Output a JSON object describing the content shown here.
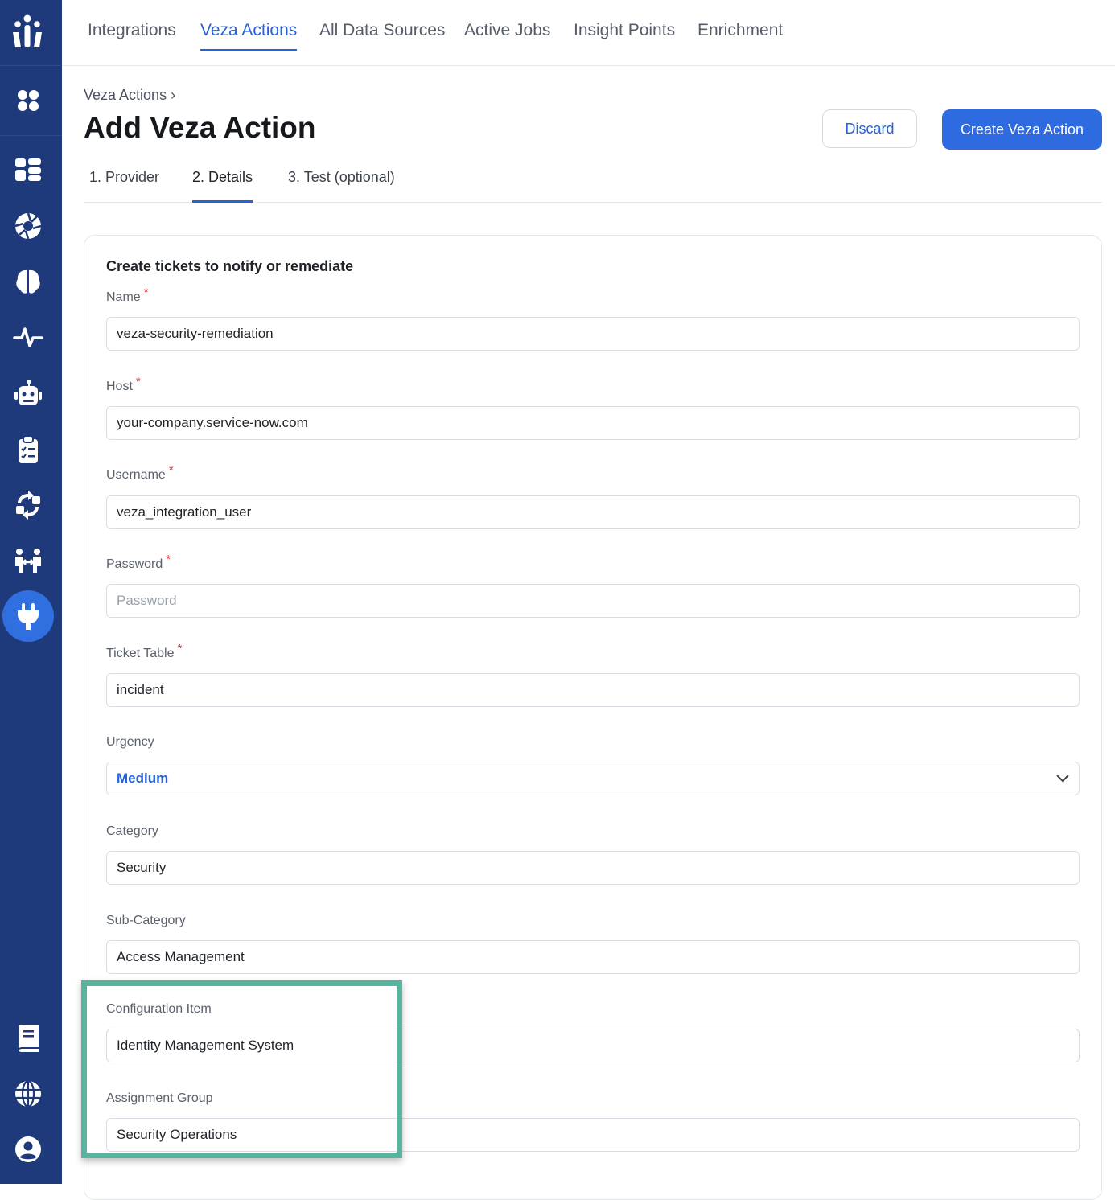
{
  "nav": {
    "tabs": [
      "Integrations",
      "Veza Actions",
      "All Data Sources",
      "Active Jobs",
      "Insight Points",
      "Enrichment"
    ],
    "active_tab": "Veza Actions"
  },
  "sidebar": {
    "icons": [
      "veza-logo-icon",
      "apps-grid-icon",
      "dashboard-icon",
      "shutter-icon",
      "brain-icon",
      "activity-pulse-icon",
      "robot-icon",
      "clipboard-icon",
      "sync-icon",
      "access-transfer-icon",
      "plug-icon",
      "book-icon",
      "globe-icon",
      "user-circle-icon"
    ],
    "active": "plug-icon"
  },
  "header": {
    "breadcrumb": "Veza Actions",
    "breadcrumb_sep": "›",
    "title": "Add Veza Action",
    "discard_label": "Discard",
    "create_label": "Create Veza Action"
  },
  "steps": [
    "1. Provider",
    "2. Details",
    "3. Test (optional)"
  ],
  "form": {
    "title": "Create tickets to notify or remediate",
    "required_mark": "*",
    "name": {
      "label": "Name",
      "value": "veza-security-remediation"
    },
    "host": {
      "label": "Host",
      "value": "your-company.service-now.com"
    },
    "username": {
      "label": "Username",
      "value": "veza_integration_user"
    },
    "password": {
      "label": "Password",
      "placeholder": "Password"
    },
    "ticket_table": {
      "label": "Ticket Table",
      "value": "incident"
    },
    "urgency": {
      "label": "Urgency",
      "value": "Medium"
    },
    "category": {
      "label": "Category",
      "value": "Security"
    },
    "sub_category": {
      "label": "Sub-Category",
      "value": "Access Management"
    },
    "configuration_item": {
      "label": "Configuration Item",
      "value": "Identity Management System"
    },
    "assignment_group": {
      "label": "Assignment Group",
      "value": "Security Operations"
    }
  },
  "colors": {
    "sidebar": "#1e3a7b",
    "accent": "#2563d8",
    "highlight": "#57b59f",
    "required": "#d93a3a"
  }
}
